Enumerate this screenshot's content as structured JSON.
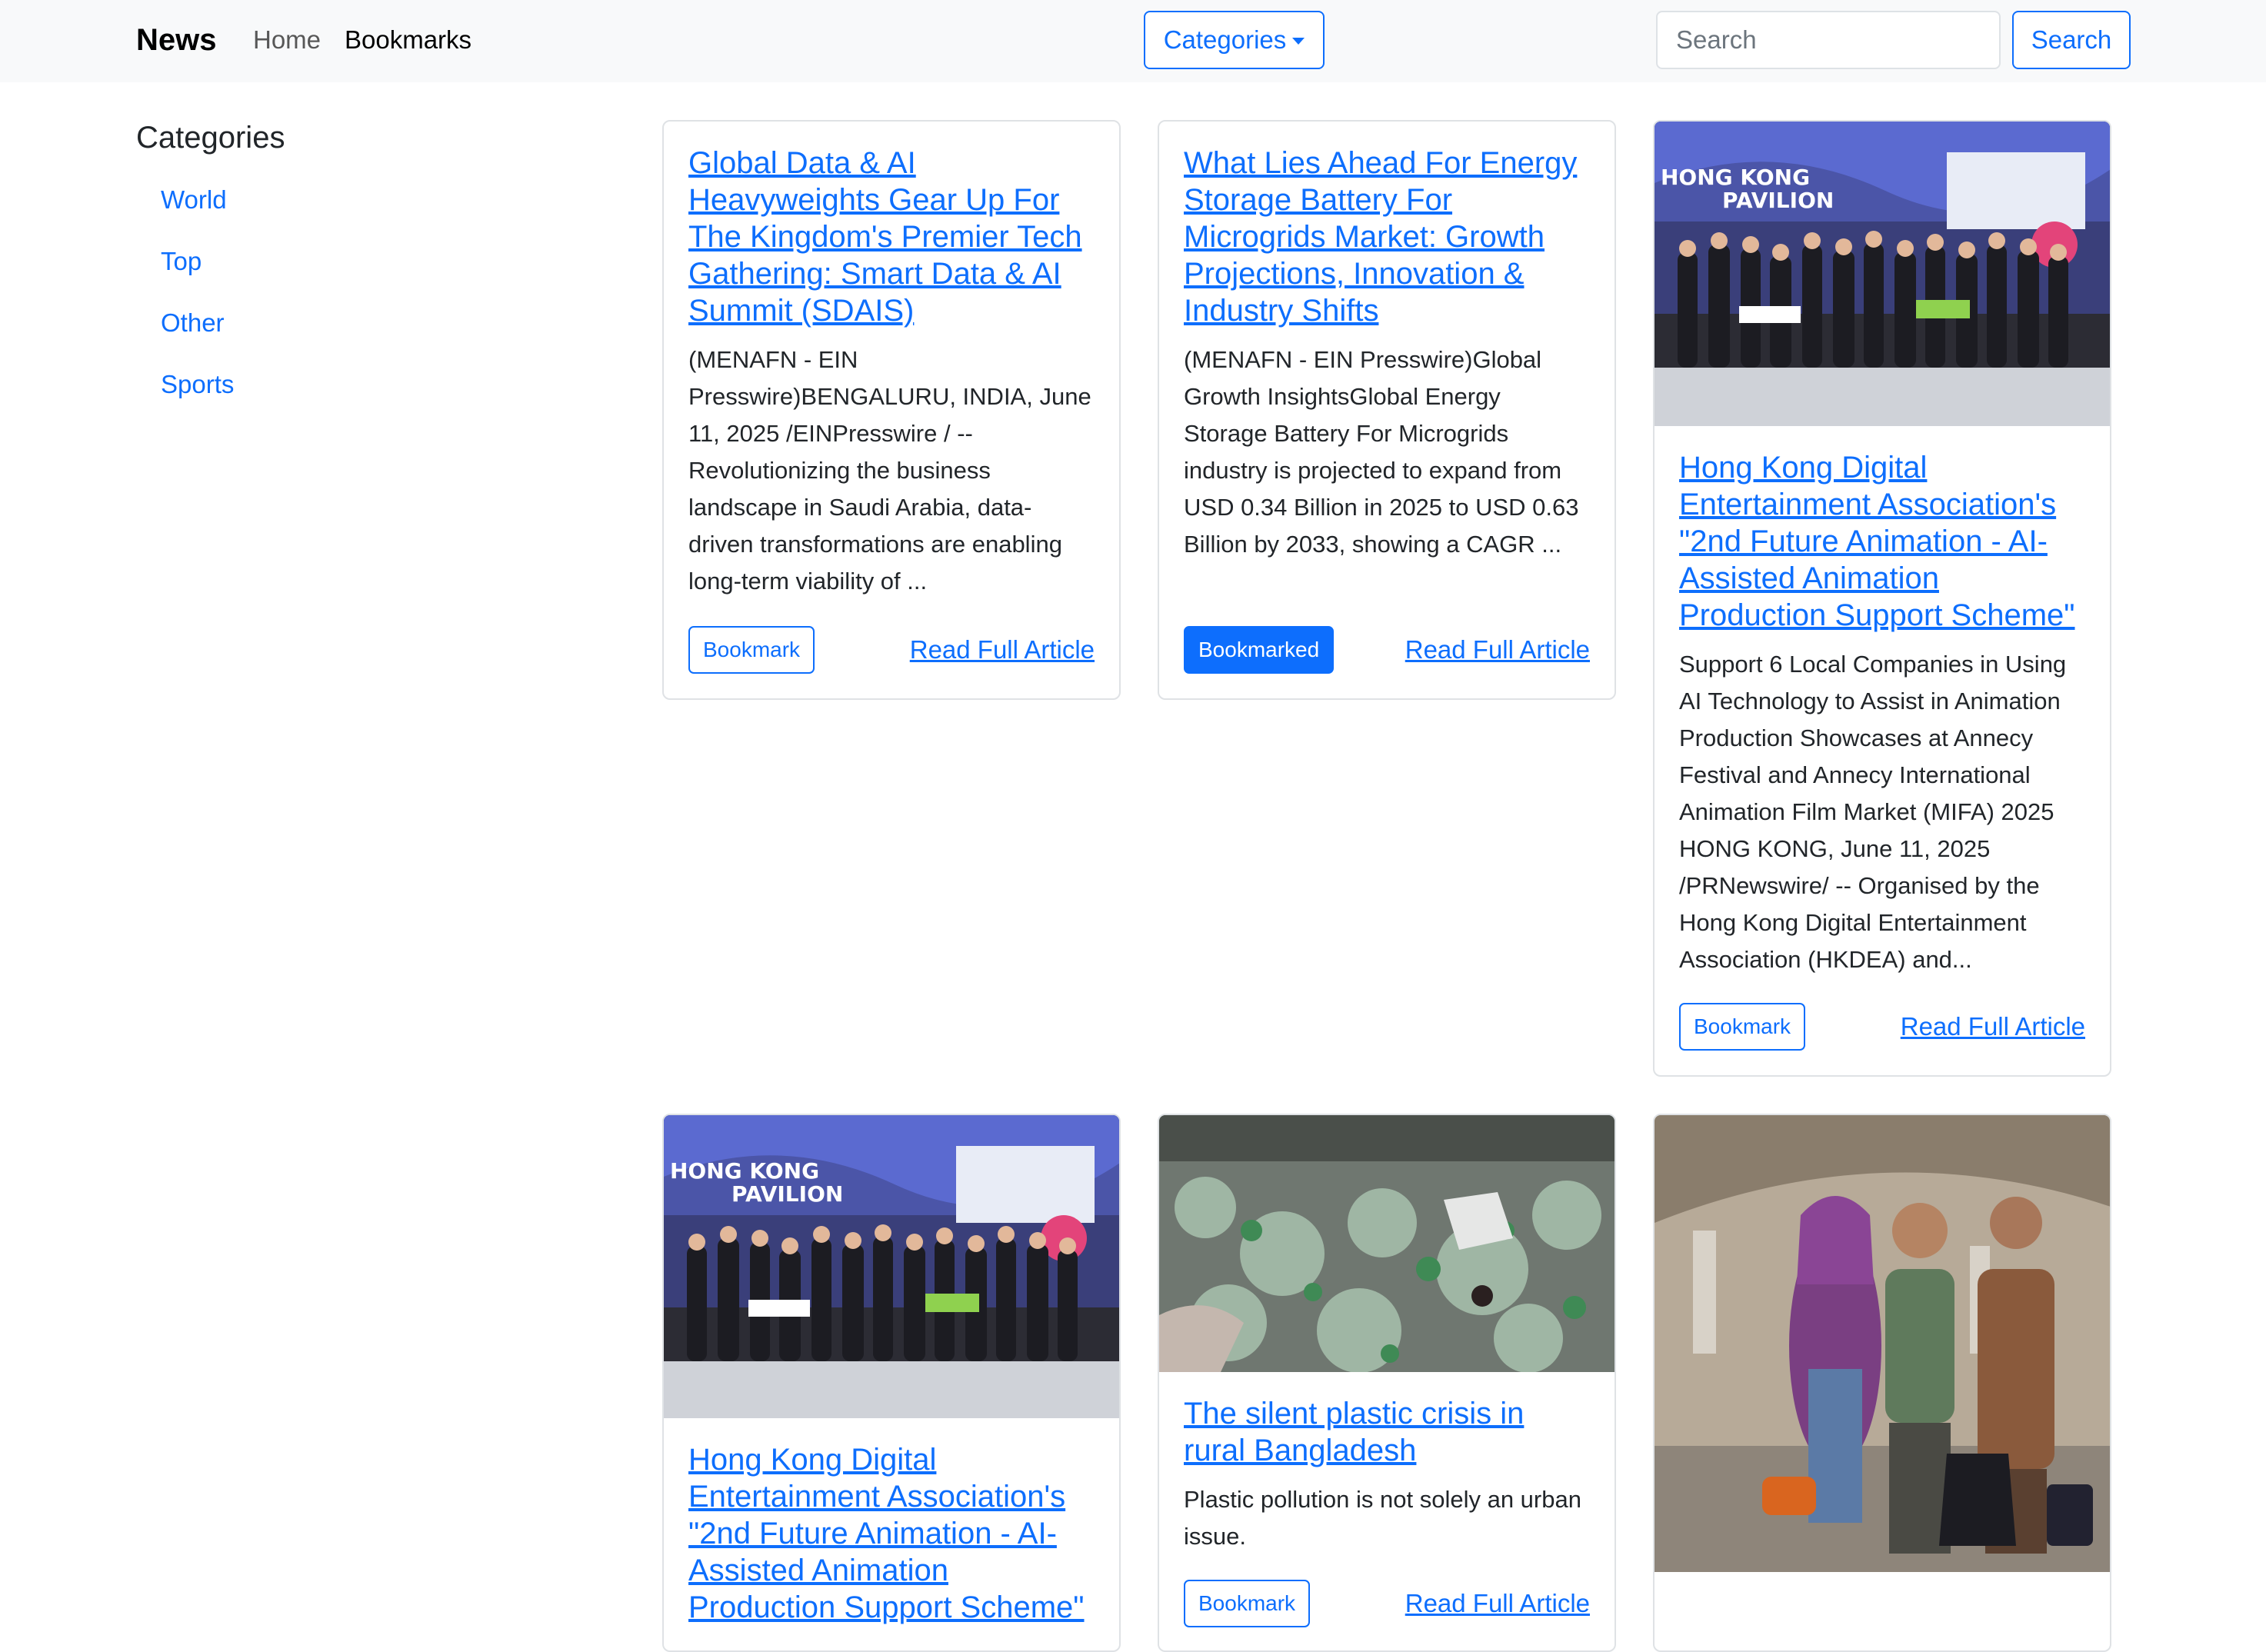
{
  "navbar": {
    "brand": "News",
    "links": [
      "Home",
      "Bookmarks"
    ],
    "categories_label": "Categories",
    "search_placeholder": "Search",
    "search_button": "Search"
  },
  "sidebar": {
    "title": "Categories",
    "items": [
      "World",
      "Top",
      "Other",
      "Sports"
    ]
  },
  "cards": [
    {
      "title": "Global Data & AI Heavyweights Gear Up For The Kingdom's Premier Tech Gathering: Smart Data & AI Summit (SDAIS)",
      "text": "(MENAFN - EIN Presswire)BENGALURU, INDIA, June 11, 2025 /EINPresswire / -- Revolutionizing the business landscape in Saudi Arabia, data-driven transformations are enabling long-term viability of ...",
      "bookmark_label": "Bookmark",
      "bookmarked": false,
      "read_label": "Read Full Article"
    },
    {
      "title": "What Lies Ahead For Energy Storage Battery For Microgrids Market: Growth Projections, Innovation & Industry Shifts",
      "text": "(MENAFN - EIN Presswire)Global Growth InsightsGlobal Energy Storage Battery For Microgrids industry is projected to expand from USD 0.34 Billion in 2025 to USD 0.63 Billion by 2033, showing a CAGR ...",
      "bookmark_label": "Bookmarked",
      "bookmarked": true,
      "read_label": "Read Full Article"
    },
    {
      "image": "pavilion-photo",
      "image_text": [
        "HONG KONG",
        "PAVILION"
      ],
      "title": "Hong Kong Digital Entertainment Association's \"2nd Future Animation - AI-Assisted Animation Production Support Scheme\"",
      "text": "Support 6 Local Companies in Using AI Technology to Assist in Animation Production Showcases at Annecy Festival and Annecy International Animation Film Market (MIFA) 2025 HONG KONG, June 11, 2025 /PRNewswire/ -- Organised by the Hong Kong Digital Entertainment Association (HKDEA) and...",
      "bookmark_label": "Bookmark",
      "bookmarked": false,
      "read_label": "Read Full Article"
    },
    {
      "image": "pavilion-photo",
      "image_text": [
        "HONG KONG",
        "PAVILION"
      ],
      "title": "Hong Kong Digital Entertainment Association's \"2nd Future Animation - AI-Assisted Animation Production Support Scheme\"",
      "text": "",
      "bookmark_label": "",
      "bookmarked": false,
      "read_label": ""
    },
    {
      "image": "plastic-waste-photo",
      "title": "The silent plastic crisis in rural Bangladesh",
      "text": "Plastic pollution is not solely an urban issue.",
      "bookmark_label": "Bookmark",
      "bookmarked": false,
      "read_label": "Read Full Article"
    },
    {
      "image": "travellers-photo",
      "title": "",
      "text": "",
      "bookmark_label": "",
      "bookmarked": false,
      "read_label": ""
    }
  ],
  "colors": {
    "primary": "#0d6efd",
    "navbar_bg": "#f8f9fa",
    "text": "#212529"
  },
  "icons": {
    "dropdown": "caret-down-icon"
  }
}
